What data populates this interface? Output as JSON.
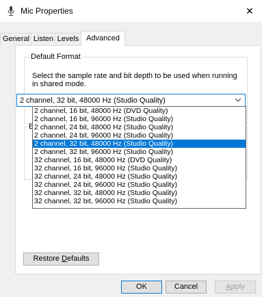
{
  "window": {
    "title": "Mic Properties",
    "close_glyph": "✕"
  },
  "tabs": [
    {
      "label": "General"
    },
    {
      "label": "Listen"
    },
    {
      "label": "Levels"
    },
    {
      "label": "Advanced",
      "active": true
    }
  ],
  "default_format": {
    "legend": "Default Format",
    "description": "Select the sample rate and bit depth to be used when running in shared mode.",
    "selected_value": "2 channel, 32 bit, 48000 Hz (Studio Quality)"
  },
  "exclusive_group": {
    "legend_visible": "E"
  },
  "dropdown": {
    "options": [
      "2 channel, 16 bit, 48000 Hz (DVD Quality)",
      "2 channel, 16 bit, 96000 Hz (Studio Quality)",
      "2 channel, 24 bit, 48000 Hz (Studio Quality)",
      "2 channel, 24 bit, 96000 Hz (Studio Quality)",
      "2 channel, 32 bit, 48000 Hz (Studio Quality)",
      "2 channel, 32 bit, 96000 Hz (Studio Quality)",
      "32 channel, 16 bit, 48000 Hz (DVD Quality)",
      "32 channel, 16 bit, 96000 Hz (Studio Quality)",
      "32 channel, 24 bit, 48000 Hz (Studio Quality)",
      "32 channel, 24 bit, 96000 Hz (Studio Quality)",
      "32 channel, 32 bit, 48000 Hz (Studio Quality)",
      "32 channel, 32 bit, 96000 Hz (Studio Quality)"
    ],
    "selected_index": 4
  },
  "buttons": {
    "restore_pre": "Restore ",
    "restore_accel": "D",
    "restore_post": "efaults",
    "ok": "OK",
    "cancel": "Cancel",
    "apply_accel": "A",
    "apply_post": "pply"
  },
  "colors": {
    "accent": "#0078d7",
    "selection_text": "#ffffff"
  },
  "icons": {
    "app": "microphone-icon",
    "close": "close-icon",
    "combo": "chevron-down-icon"
  }
}
